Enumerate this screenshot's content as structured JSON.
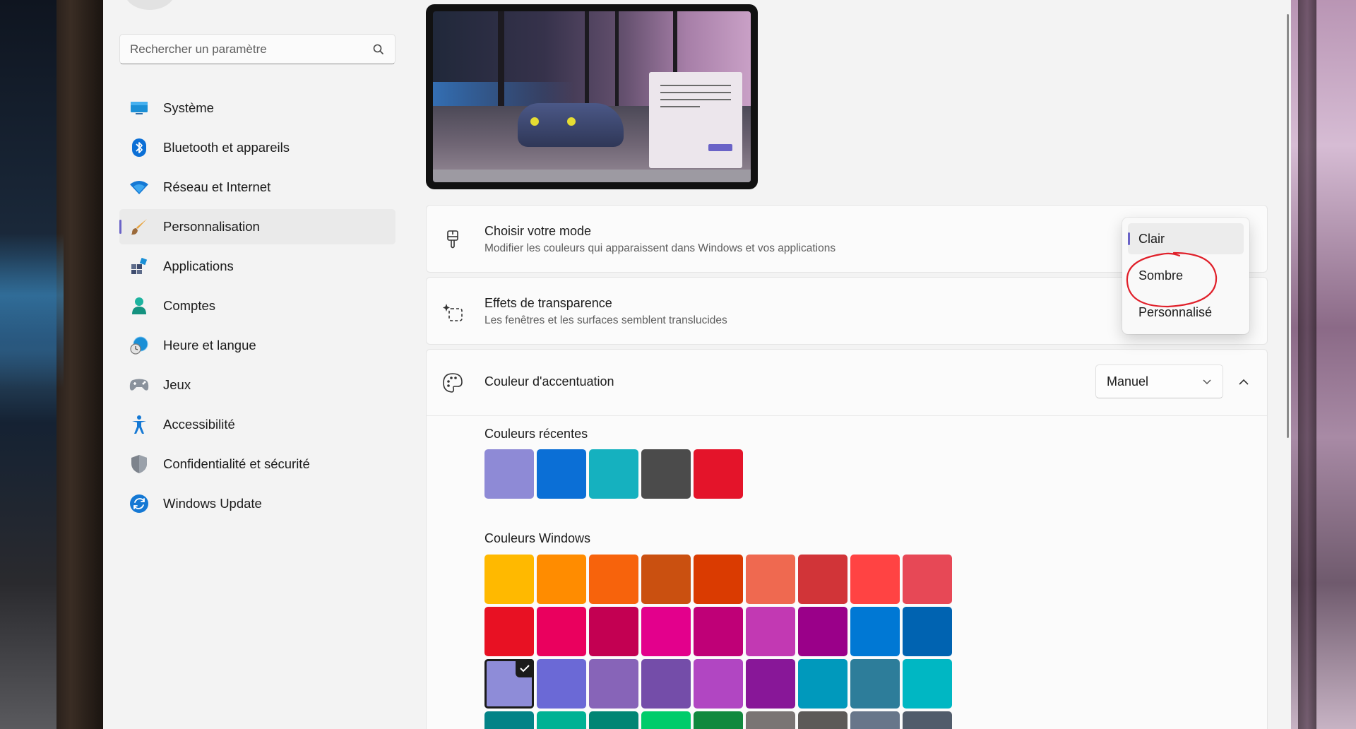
{
  "search": {
    "placeholder": "Rechercher un paramètre"
  },
  "sidebar": {
    "items": [
      {
        "label": "Système",
        "icon": "display-icon"
      },
      {
        "label": "Bluetooth et appareils",
        "icon": "bluetooth-icon"
      },
      {
        "label": "Réseau et Internet",
        "icon": "wifi-icon"
      },
      {
        "label": "Personnalisation",
        "icon": "brush-icon",
        "active": true
      },
      {
        "label": "Applications",
        "icon": "apps-icon"
      },
      {
        "label": "Comptes",
        "icon": "person-icon"
      },
      {
        "label": "Heure et langue",
        "icon": "globe-clock-icon"
      },
      {
        "label": "Jeux",
        "icon": "gamepad-icon"
      },
      {
        "label": "Accessibilité",
        "icon": "accessibility-icon"
      },
      {
        "label": "Confidentialité et sécurité",
        "icon": "shield-icon"
      },
      {
        "label": "Windows Update",
        "icon": "update-icon"
      }
    ]
  },
  "mode_card": {
    "title": "Choisir votre mode",
    "subtitle": "Modifier les couleurs qui apparaissent dans Windows et vos applications"
  },
  "transparency_card": {
    "title": "Effets de transparence",
    "subtitle": "Les fenêtres et les surfaces semblent translucides"
  },
  "accent_card": {
    "title": "Couleur d'accentuation",
    "dropdown_value": "Manuel",
    "recent_label": "Couleurs récentes",
    "windows_label": "Couleurs Windows",
    "recent_colors": [
      "#8e8ad6",
      "#0b6fd6",
      "#15b1bf",
      "#4b4b4b",
      "#e4142a"
    ],
    "windows_colors": [
      [
        "#ffb900",
        "#ff8c00",
        "#f7630c",
        "#ca5010",
        "#da3b01",
        "#ef6950",
        "#d13438",
        "#ff4343",
        "#e74856"
      ],
      [
        "#e81123",
        "#ea005e",
        "#c30052",
        "#e3008c",
        "#bf0077",
        "#c239b3",
        "#9a0089",
        "#0078d4",
        "#0063b1"
      ],
      [
        "#8e8cd8",
        "#6b69d6",
        "#8764b8",
        "#744da9",
        "#b146c2",
        "#881798",
        "#0099bc",
        "#2d7d9a",
        "#00b7c3"
      ],
      [
        "#038387",
        "#00b294",
        "#018574",
        "#00cc6a",
        "#10893e",
        "#7a7574",
        "#5d5a58",
        "#68768a",
        "#515c6b"
      ]
    ],
    "selected_color": "#8e8cd8"
  },
  "mode_menu": {
    "options": [
      "Clair",
      "Sombre",
      "Personnalisé"
    ],
    "selected": "Clair",
    "annotation_color": "#e0202a"
  },
  "colors": {
    "accent": "#6a63c7",
    "window_bg": "#f3f3f3",
    "card_bg": "#fbfbfb"
  }
}
